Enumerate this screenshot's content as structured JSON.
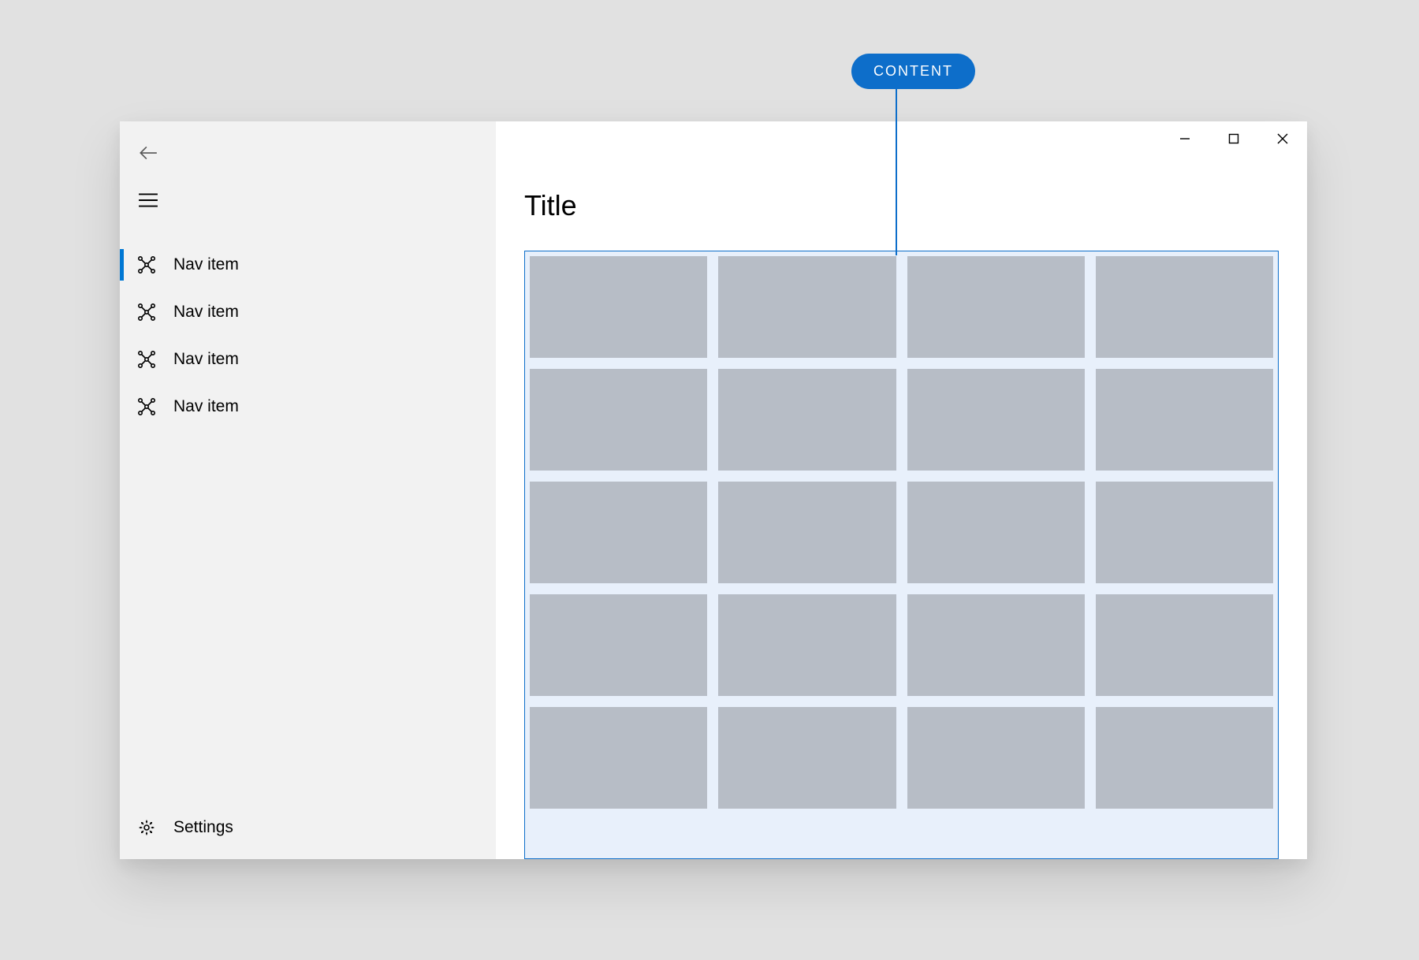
{
  "annotation": {
    "label": "CONTENT"
  },
  "sidebar": {
    "nav_items": [
      {
        "label": "Nav item",
        "selected": true
      },
      {
        "label": "Nav item",
        "selected": false
      },
      {
        "label": "Nav item",
        "selected": false
      },
      {
        "label": "Nav item",
        "selected": false
      }
    ],
    "settings_label": "Settings"
  },
  "content": {
    "title": "Title",
    "grid": {
      "columns": 4,
      "rows": 5
    }
  },
  "colors": {
    "accent": "#0078d4",
    "annotation": "#0d6eca",
    "tile": "#b7bdc6",
    "grid_bg": "#e8f0fb",
    "sidebar_bg": "#f2f2f2"
  }
}
